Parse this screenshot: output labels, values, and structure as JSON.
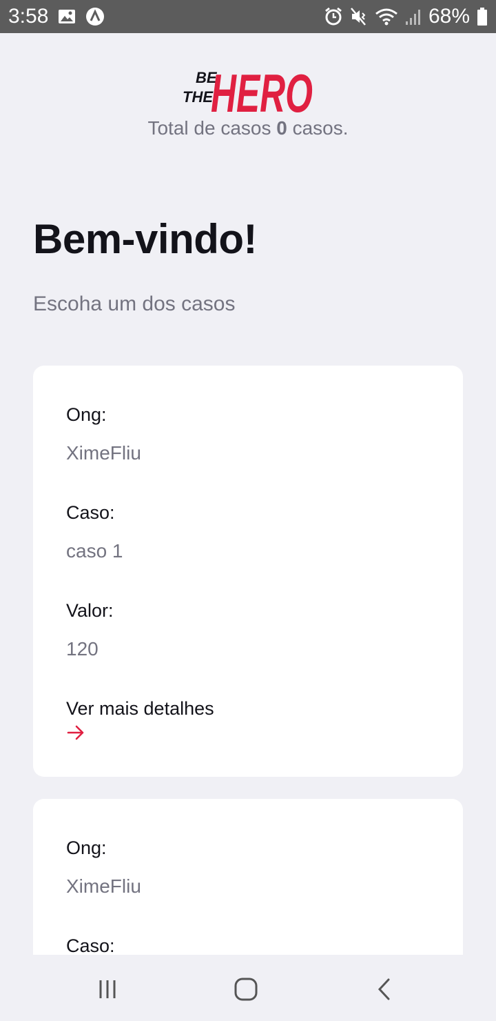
{
  "status_bar": {
    "time": "3:58",
    "battery": "68%",
    "icons": [
      "image-icon",
      "app-a-icon",
      "alarm-icon",
      "mute-vibrate-icon",
      "wifi-icon",
      "signal-icon",
      "battery-icon"
    ]
  },
  "header": {
    "logo_alt": "BE THE HERO",
    "logo_small_1": "BE",
    "logo_small_2": "THE",
    "logo_big": "HERO",
    "total_prefix": "Total de casos ",
    "total_count": "0",
    "total_suffix": " casos."
  },
  "main": {
    "title": "Bem-vindo!",
    "subtitle": "Escoha um dos casos"
  },
  "incidents": [
    {
      "ong_label": "Ong:",
      "ong_value": "XimeFliu",
      "case_label": "Caso:",
      "case_value": "caso 1",
      "value_label": "Valor:",
      "value_value": "120",
      "details_label": "Ver mais detalhes"
    },
    {
      "ong_label": "Ong:",
      "ong_value": "XimeFliu",
      "case_label": "Caso:",
      "case_value": "",
      "value_label": "",
      "value_value": "",
      "details_label": ""
    }
  ],
  "colors": {
    "brand_red": "#e02041",
    "background": "#f0f0f5",
    "text_dark": "#13131a",
    "text_gray": "#737380"
  },
  "nav_bar": {
    "icons": [
      "recent-apps-icon",
      "home-icon",
      "back-icon"
    ]
  }
}
